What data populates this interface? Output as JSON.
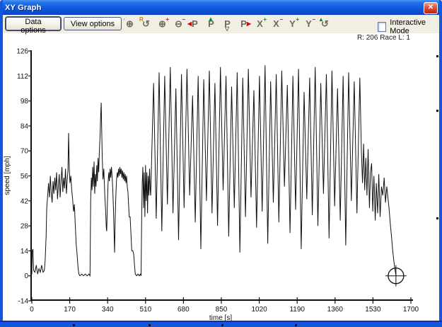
{
  "window": {
    "title": "XY Graph",
    "close_glyph": "✕"
  },
  "toolbar": {
    "buttons": [
      {
        "label": "Data options"
      },
      {
        "label": "View options"
      }
    ],
    "icons": [
      {
        "name": "zoom-to-rectangle-icon",
        "main": "⊕",
        "badge": "▫",
        "badge_pos": "tl",
        "badge_color": "#888878"
      },
      {
        "name": "reset-zoom-icon",
        "main": "↺",
        "badge": "R",
        "badge_pos": "tl",
        "badge_color": "#b8860b"
      },
      {
        "name": "zoom-in-icon",
        "main": "⊕",
        "badge": "+",
        "badge_pos": "tr",
        "badge_color": "#cc1111"
      },
      {
        "name": "zoom-out-icon",
        "main": "⊖",
        "badge": "−",
        "badge_pos": "tr",
        "badge_color": "#cc1111"
      },
      {
        "name": "prev-point-icon",
        "main": "P",
        "badge": "◀",
        "badge_pos": "l",
        "badge_color": "#cc1111"
      },
      {
        "name": "flag-up-icon",
        "main": "P",
        "badge": "▲",
        "badge_pos": "t",
        "badge_color": "#0a8a0a"
      },
      {
        "name": "flag-down-icon",
        "main": "P",
        "badge": "▽",
        "badge_pos": "b",
        "badge_color": "#55554a"
      },
      {
        "name": "next-point-icon",
        "main": "P",
        "badge": "▶",
        "badge_pos": "r",
        "badge_color": "#cc1111"
      },
      {
        "name": "x-axis-expand-icon",
        "main": "X",
        "badge": "+",
        "badge_pos": "tr",
        "badge_color": "#0a8a0a"
      },
      {
        "name": "x-axis-shrink-icon",
        "main": "X",
        "badge": "−",
        "badge_pos": "tr",
        "badge_color": "#cc1111"
      },
      {
        "name": "y-axis-expand-icon",
        "main": "Y",
        "badge": "+",
        "badge_pos": "tr",
        "badge_color": "#0a8a0a"
      },
      {
        "name": "y-axis-shrink-icon",
        "main": "Y",
        "badge": "−",
        "badge_pos": "tr",
        "badge_color": "#cc1111"
      },
      {
        "name": "autoscale-icon",
        "main": "↺",
        "badge": "▲",
        "badge_pos": "tl",
        "badge_color": "#0a8a0a"
      }
    ],
    "checkbox": {
      "label": "Interactive Mode",
      "checked": false
    }
  },
  "status": {
    "text": "R: 206 Race  L: 1"
  },
  "colors": {
    "window_border": "#1456dd",
    "titlebar": "#1257dd",
    "close_button": "#c8331e",
    "toolbar_bg": "#f1efe3",
    "plot_bg": "#ffffff",
    "trace": "#111111"
  },
  "chart_data": {
    "type": "line",
    "title": "",
    "xlabel": "time [s]",
    "ylabel": "speed [mph]",
    "xlim": [
      0,
      1700
    ],
    "ylim": [
      -14,
      126
    ],
    "x_ticks": [
      0,
      170,
      340,
      510,
      680,
      850,
      1020,
      1190,
      1360,
      1530,
      1700
    ],
    "y_ticks": [
      -14,
      0,
      14,
      28,
      42,
      56,
      70,
      84,
      98,
      112,
      126
    ],
    "grid": false,
    "legend": "none",
    "cursor": {
      "t": 1633,
      "v": 0
    },
    "series": [
      {
        "name": "speed [mph]",
        "color": "#111111",
        "points": [
          [
            0,
            1
          ],
          [
            2,
            14
          ],
          [
            5,
            15
          ],
          [
            8,
            3
          ],
          [
            14,
            2
          ],
          [
            20,
            6
          ],
          [
            26,
            1
          ],
          [
            32,
            4
          ],
          [
            38,
            2
          ],
          [
            44,
            6
          ],
          [
            50,
            2
          ],
          [
            56,
            3
          ],
          [
            60,
            9
          ],
          [
            64,
            22
          ],
          [
            67,
            38
          ],
          [
            71,
            45
          ],
          [
            75,
            52
          ],
          [
            79,
            44
          ],
          [
            83,
            56
          ],
          [
            87,
            47
          ],
          [
            91,
            41
          ],
          [
            95,
            53
          ],
          [
            99,
            46
          ],
          [
            103,
            55
          ],
          [
            107,
            48
          ],
          [
            111,
            58
          ],
          [
            115,
            43
          ],
          [
            119,
            50
          ],
          [
            123,
            57
          ],
          [
            127,
            44
          ],
          [
            131,
            53
          ],
          [
            135,
            61
          ],
          [
            139,
            47
          ],
          [
            143,
            55
          ],
          [
            147,
            49
          ],
          [
            151,
            60
          ],
          [
            155,
            46
          ],
          [
            159,
            54
          ],
          [
            162,
            59
          ],
          [
            165,
            80
          ],
          [
            168,
            60
          ],
          [
            171,
            52
          ],
          [
            175,
            56
          ],
          [
            179,
            48
          ],
          [
            183,
            43
          ],
          [
            187,
            36
          ],
          [
            191,
            40
          ],
          [
            195,
            28
          ],
          [
            199,
            18
          ],
          [
            203,
            12
          ],
          [
            207,
            5
          ],
          [
            211,
            1
          ],
          [
            216,
            0
          ],
          [
            224,
            1
          ],
          [
            232,
            0
          ],
          [
            240,
            1
          ],
          [
            248,
            0
          ],
          [
            256,
            1
          ],
          [
            261,
            0
          ],
          [
            264,
            42
          ],
          [
            267,
            55
          ],
          [
            270,
            48
          ],
          [
            273,
            61
          ],
          [
            276,
            50
          ],
          [
            279,
            64
          ],
          [
            282,
            46
          ],
          [
            285,
            57
          ],
          [
            288,
            50
          ],
          [
            291,
            62
          ],
          [
            294,
            53
          ],
          [
            297,
            66
          ],
          [
            300,
            58
          ],
          [
            303,
            70
          ],
          [
            306,
            78
          ],
          [
            309,
            90
          ],
          [
            311,
            97
          ],
          [
            313,
            84
          ],
          [
            316,
            66
          ],
          [
            319,
            54
          ],
          [
            323,
            60
          ],
          [
            327,
            46
          ],
          [
            331,
            36
          ],
          [
            334,
            27
          ],
          [
            336,
            25
          ],
          [
            339,
            41
          ],
          [
            342,
            52
          ],
          [
            345,
            58
          ],
          [
            348,
            53
          ],
          [
            351,
            60
          ],
          [
            354,
            55
          ],
          [
            357,
            61
          ],
          [
            360,
            56
          ],
          [
            363,
            48
          ],
          [
            366,
            38
          ],
          [
            369,
            24
          ],
          [
            371,
            13
          ],
          [
            374,
            32
          ],
          [
            377,
            46
          ],
          [
            380,
            54
          ],
          [
            383,
            58
          ],
          [
            386,
            55
          ],
          [
            389,
            60
          ],
          [
            392,
            56
          ],
          [
            395,
            61
          ],
          [
            398,
            57
          ],
          [
            401,
            60
          ],
          [
            404,
            55
          ],
          [
            407,
            59
          ],
          [
            410,
            54
          ],
          [
            413,
            58
          ],
          [
            416,
            53
          ],
          [
            419,
            57
          ],
          [
            422,
            52
          ],
          [
            425,
            56
          ],
          [
            428,
            50
          ],
          [
            431,
            47
          ],
          [
            434,
            40
          ],
          [
            437,
            33
          ],
          [
            441,
            33
          ],
          [
            444,
            25
          ],
          [
            448,
            14
          ],
          [
            453,
            14
          ],
          [
            457,
            12
          ],
          [
            461,
            5
          ],
          [
            464,
            1
          ],
          [
            470,
            0
          ],
          [
            476,
            1
          ],
          [
            482,
            0
          ],
          [
            487,
            1
          ],
          [
            490,
            0
          ],
          [
            493,
            35
          ],
          [
            495,
            52
          ],
          [
            498,
            61
          ],
          [
            501,
            38
          ],
          [
            504,
            58
          ],
          [
            507,
            33
          ],
          [
            510,
            62
          ],
          [
            513,
            42
          ],
          [
            516,
            58
          ],
          [
            519,
            35
          ],
          [
            522,
            56
          ],
          [
            525,
            45
          ],
          [
            528,
            60
          ],
          [
            531,
            48
          ],
          [
            533,
            45
          ],
          [
            546,
            108
          ],
          [
            558,
            32
          ],
          [
            571,
            114
          ],
          [
            583,
            25
          ],
          [
            596,
            112
          ],
          [
            608,
            40
          ],
          [
            621,
            117
          ],
          [
            633,
            35
          ],
          [
            646,
            105
          ],
          [
            658,
            20
          ],
          [
            671,
            113
          ],
          [
            683,
            38
          ],
          [
            696,
            116
          ],
          [
            708,
            45
          ],
          [
            721,
            101
          ],
          [
            733,
            30
          ],
          [
            746,
            112
          ],
          [
            758,
            15
          ],
          [
            771,
            110
          ],
          [
            783,
            42
          ],
          [
            796,
            115
          ],
          [
            808,
            35
          ],
          [
            821,
            108
          ],
          [
            833,
            28
          ],
          [
            846,
            117
          ],
          [
            858,
            48
          ],
          [
            871,
            112
          ],
          [
            883,
            22
          ],
          [
            896,
            106
          ],
          [
            908,
            38
          ],
          [
            921,
            114
          ],
          [
            933,
            13
          ],
          [
            946,
            111
          ],
          [
            958,
            33
          ],
          [
            971,
            116
          ],
          [
            983,
            44
          ],
          [
            996,
            104
          ],
          [
            1008,
            27
          ],
          [
            1021,
            112
          ],
          [
            1033,
            36
          ],
          [
            1046,
            118
          ],
          [
            1058,
            18
          ],
          [
            1071,
            109
          ],
          [
            1083,
            41
          ],
          [
            1096,
            113
          ],
          [
            1108,
            30
          ],
          [
            1121,
            115
          ],
          [
            1133,
            50
          ],
          [
            1146,
            107
          ],
          [
            1158,
            24
          ],
          [
            1171,
            112
          ],
          [
            1183,
            37
          ],
          [
            1196,
            116
          ],
          [
            1208,
            15
          ],
          [
            1221,
            103
          ],
          [
            1233,
            43
          ],
          [
            1246,
            111
          ],
          [
            1258,
            34
          ],
          [
            1271,
            117
          ],
          [
            1283,
            28
          ],
          [
            1296,
            108
          ],
          [
            1308,
            46
          ],
          [
            1321,
            113
          ],
          [
            1333,
            21
          ],
          [
            1346,
            115
          ],
          [
            1358,
            39
          ],
          [
            1371,
            105
          ],
          [
            1383,
            31
          ],
          [
            1396,
            112
          ],
          [
            1408,
            17
          ],
          [
            1421,
            114
          ],
          [
            1433,
            42
          ],
          [
            1446,
            109
          ],
          [
            1458,
            35
          ],
          [
            1471,
            111
          ],
          [
            1478,
            70
          ],
          [
            1483,
            52
          ],
          [
            1488,
            74
          ],
          [
            1493,
            48
          ],
          [
            1498,
            66
          ],
          [
            1503,
            45
          ],
          [
            1508,
            71
          ],
          [
            1514,
            38
          ],
          [
            1519,
            58
          ],
          [
            1524,
            63
          ],
          [
            1529,
            36
          ],
          [
            1534,
            56
          ],
          [
            1540,
            31
          ],
          [
            1545,
            52
          ],
          [
            1551,
            35
          ],
          [
            1556,
            57
          ],
          [
            1562,
            33
          ],
          [
            1568,
            50
          ],
          [
            1574,
            45
          ],
          [
            1580,
            55
          ],
          [
            1586,
            41
          ],
          [
            1592,
            50
          ],
          [
            1597,
            44
          ],
          [
            1602,
            38
          ],
          [
            1607,
            30
          ],
          [
            1613,
            22
          ],
          [
            1618,
            15
          ],
          [
            1623,
            9
          ],
          [
            1628,
            4
          ],
          [
            1632,
            1
          ],
          [
            1634,
            0
          ]
        ]
      }
    ]
  }
}
